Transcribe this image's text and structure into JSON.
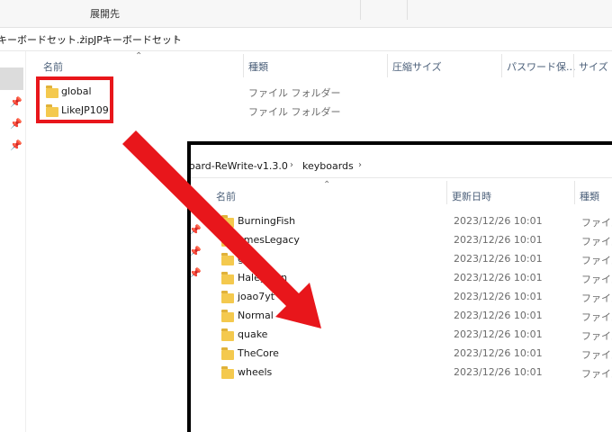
{
  "toolbar": {
    "extract_label": "展開先"
  },
  "back_window": {
    "breadcrumb": [
      "キーボードセット.zip",
      "JPキーボードセット"
    ],
    "columns": {
      "name": "名前",
      "type": "種類",
      "compressed_size": "圧縮サイズ",
      "password": "パスワード保...",
      "size": "サイズ"
    },
    "items": [
      {
        "name": "global",
        "type": "ファイル フォルダー"
      },
      {
        "name": "LikeJP109",
        "type": "ファイル フォルダー"
      }
    ]
  },
  "front_window": {
    "breadcrumb": [
      "oard-ReWrite-v1.3.0",
      "keyboards"
    ],
    "columns": {
      "name": "名前",
      "modified": "更新日時",
      "type": "種類"
    },
    "items": [
      {
        "name": "BurningFish",
        "modified": "2023/12/26 10:01",
        "type": "ファイル"
      },
      {
        "name": "amesLegacy",
        "modified": "2023/12/26 10:01",
        "type": "ファイル"
      },
      {
        "name": "g",
        "modified": "2023/12/26 10:01",
        "type": "ファイル"
      },
      {
        "name": "Haley von",
        "modified": "2023/12/26 10:01",
        "type": "ファイル"
      },
      {
        "name": "joao7yt",
        "modified": "2023/12/26 10:01",
        "type": "ファイル"
      },
      {
        "name": "Normal",
        "modified": "2023/12/26 10:01",
        "type": "ファイル"
      },
      {
        "name": "quake",
        "modified": "2023/12/26 10:01",
        "type": "ファイル"
      },
      {
        "name": "TheCore",
        "modified": "2023/12/26 10:01",
        "type": "ファイル"
      },
      {
        "name": "wheels",
        "modified": "2023/12/26 10:01",
        "type": "ファイル"
      }
    ]
  },
  "annotation": {
    "highlight_color": "#e8161b",
    "arrow_color": "#e8161b"
  },
  "icons": {
    "folder": "folder-icon",
    "pin": "pin-icon",
    "chevron": "chevron-right-icon",
    "sort": "sort-up-icon"
  }
}
